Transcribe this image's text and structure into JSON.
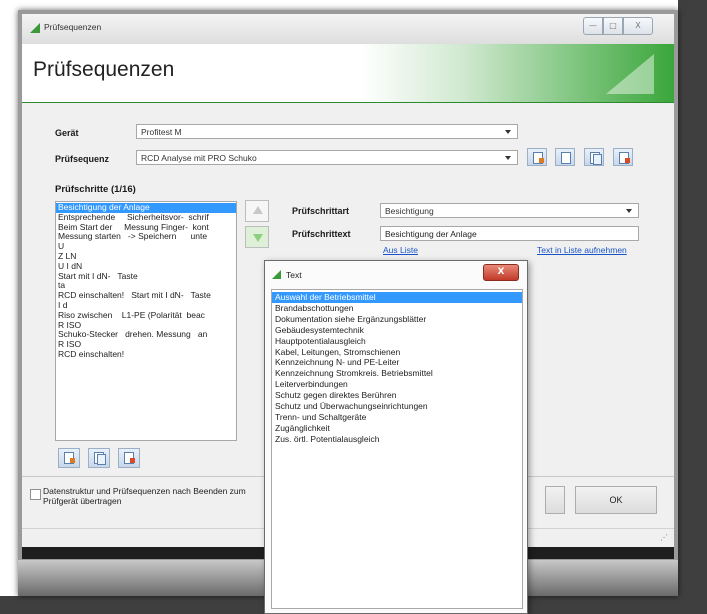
{
  "window": {
    "title": "Prüfsequenzen",
    "min_glyph": "—",
    "max_glyph": "□",
    "close_glyph": "X"
  },
  "banner": {
    "title": "Prüfsequenzen"
  },
  "form": {
    "device_label": "Gerät",
    "device_value": "Profitest M",
    "sequence_label": "Prüfsequenz",
    "sequence_value": "RCD Analyse mit PRO Schuko",
    "steps_label": "Prüfschritte (1/16)",
    "step_type_label": "Prüfschrittart",
    "step_type_value": "Besichtigung",
    "step_text_label": "Prüfschrittext",
    "step_text_value": "Besichtigung der Anlage",
    "from_list_link": "Aus Liste",
    "add_to_list_link": "Text in Liste aufnehmen"
  },
  "steps": [
    "Besichtigung der Anlage",
    "Entsprechende     Sicherheitsvor-  schrif",
    "Beim Start der     Messung Finger-  kont",
    "Messung starten   -> Speichern      unte",
    "U",
    "Z LN",
    "U I dN",
    "Start mit I dN-   Taste",
    "ta",
    "RCD einschalten!   Start mit I dN-   Taste",
    "I d",
    "Riso zwischen    L1-PE (Polarität  beac",
    "R ISO",
    "Schuko-Stecker   drehen. Messung   an",
    "R ISO",
    "RCD einschalten!"
  ],
  "footer": {
    "checkbox_label": "Datenstruktur und Prüfsequenzen nach Beenden zum Prüfgerät übertragen",
    "ok_label": "OK",
    "grip": "⋰"
  },
  "popup": {
    "title": "Text",
    "close_glyph": "X",
    "items": [
      "Auswahl der Betriebsmittel",
      "Brandabschottungen",
      "Dokumentation siehe Ergänzungsblätter",
      "Gebäudesystemtechnik",
      "Hauptpotentialausgleich",
      "Kabel, Leitungen, Stromschienen",
      "Kennzeichnung N- und PE-Leiter",
      "Kennzeichnung Stromkreis. Betriebsmittel",
      "Leiterverbindungen",
      "Schutz gegen direktes Berühren",
      "Schutz und Überwachungseinrichtungen",
      "Trenn- und Schaltgeräte",
      "Zugänglichkeit",
      "Zus. örtl. Potentialausgleich"
    ]
  }
}
